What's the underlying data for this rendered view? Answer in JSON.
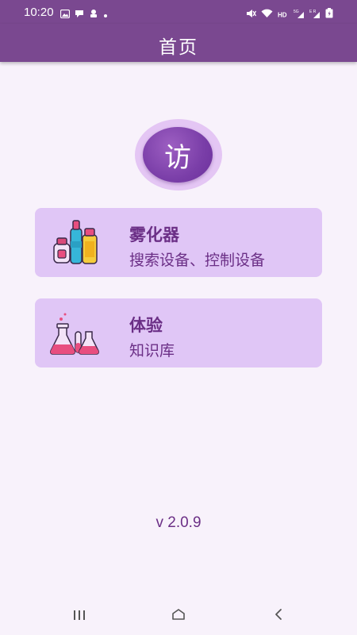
{
  "status_bar": {
    "time": "10:20",
    "left_icons": [
      "image-icon",
      "chat-icon",
      "robot-icon",
      "dot-icon"
    ],
    "right_icons": [
      "mute-icon",
      "wifi-icon",
      "hd-icon",
      "5g-signal-icon",
      "signal-icon",
      "battery-icon"
    ]
  },
  "appbar": {
    "title": "首页"
  },
  "logo": {
    "char": "访"
  },
  "cards": [
    {
      "title": "雾化器",
      "subtitle": "搜索设备、控制设备",
      "icon": "bottles-icon"
    },
    {
      "title": "体验",
      "subtitle": "知识库",
      "icon": "lab-flasks-icon"
    }
  ],
  "version": "v 2.0.9",
  "nav": {
    "recents_icon": "recents-icon",
    "home_icon": "home-icon",
    "back_icon": "back-icon"
  },
  "colors": {
    "primary": "#7a4890",
    "card_background": "#e0c6f6",
    "text_accent": "#6b2f86",
    "page_background": "#f8f2fb"
  }
}
